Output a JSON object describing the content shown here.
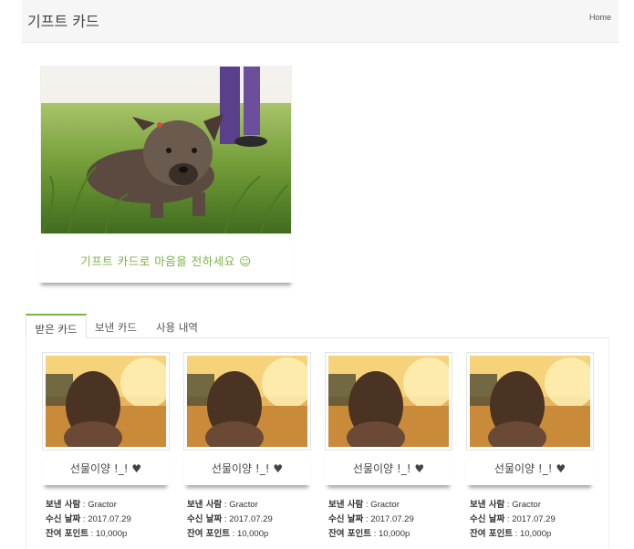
{
  "header": {
    "title": "기프트 카드",
    "home_label": "Home"
  },
  "hero": {
    "caption": "기프트 카드로 마음을 전하세요 ☺"
  },
  "tabs": [
    {
      "label": "받은 카드",
      "active": true
    },
    {
      "label": "보낸 카드",
      "active": false
    },
    {
      "label": "사용 내역",
      "active": false
    }
  ],
  "cards": [
    {
      "name": "선물이양 !_! ♥",
      "sender_label": "보낸 사람",
      "sender": "Gractor",
      "date_label": "수신 날짜",
      "date": "2017.07.29",
      "points_label": "잔여 포인트",
      "points": "10,000p"
    },
    {
      "name": "선물이양 !_! ♥",
      "sender_label": "보낸 사람",
      "sender": "Gractor",
      "date_label": "수신 날짜",
      "date": "2017.07.29",
      "points_label": "잔여 포인트",
      "points": "10,000p"
    },
    {
      "name": "선물이양 !_! ♥",
      "sender_label": "보낸 사람",
      "sender": "Gractor",
      "date_label": "수신 날짜",
      "date": "2017.07.29",
      "points_label": "잔여 포인트",
      "points": "10,000p"
    },
    {
      "name": "선물이양 !_! ♥",
      "sender_label": "보낸 사람",
      "sender": "Gractor",
      "date_label": "수신 날짜",
      "date": "2017.07.29",
      "points_label": "잔여 포인트",
      "points": "10,000p"
    }
  ],
  "colors": {
    "accent": "#7cb342",
    "header_bg": "#f6f6f6"
  }
}
